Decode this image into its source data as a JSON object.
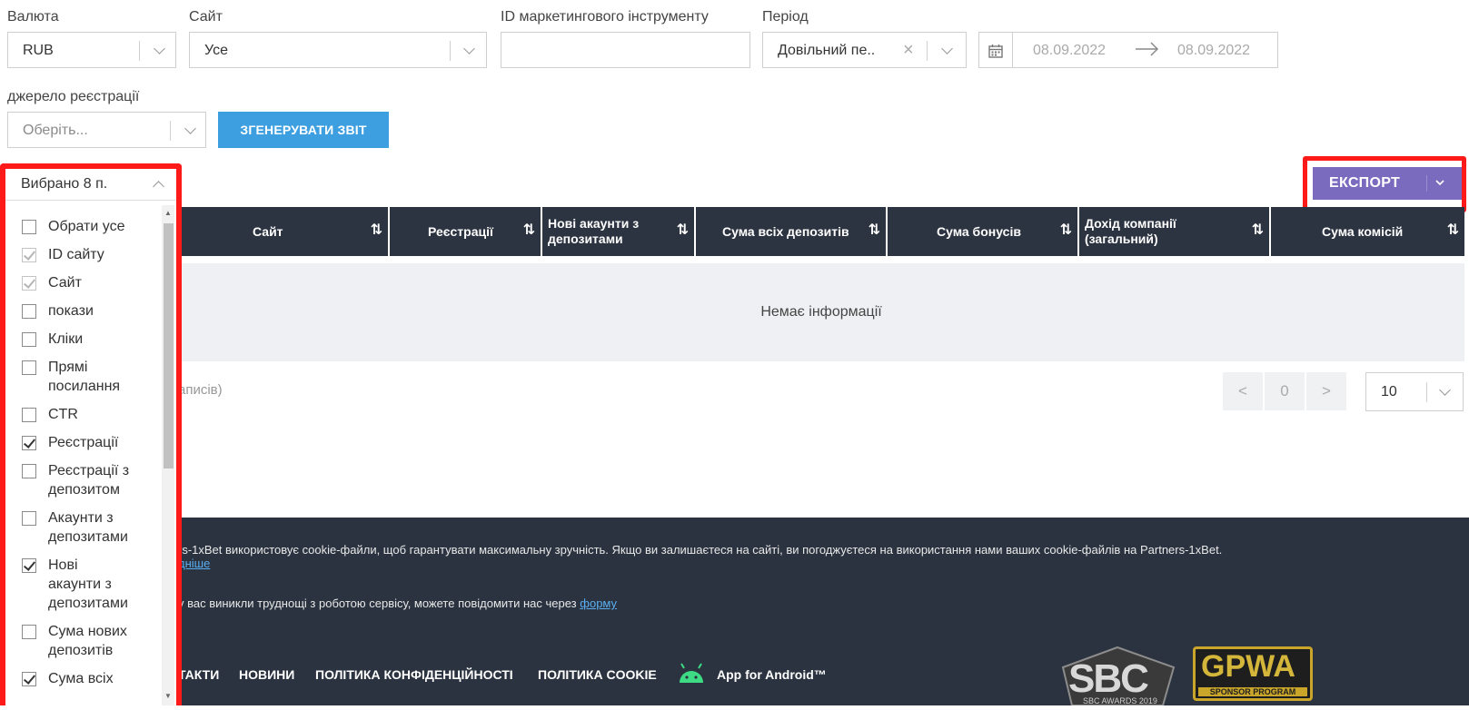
{
  "filters": {
    "currency": {
      "label": "Валюта",
      "value": "RUB"
    },
    "site": {
      "label": "Сайт",
      "value": "Усе"
    },
    "marketing_id": {
      "label": "ID маркетингового інструменту",
      "value": ""
    },
    "period": {
      "label": "Період",
      "value": "Довільний пе..",
      "date_from": "08.09.2022",
      "date_to": "08.09.2022"
    },
    "reg_source": {
      "label": "джерело реєстрації",
      "placeholder": "Оберіть..."
    },
    "generate_label": "ЗГЕНЕРУВАТИ ЗВІТ"
  },
  "export": {
    "label": "ЕКСПОРТ"
  },
  "columns_panel": {
    "title": "Вибрано 8 п.",
    "items": [
      {
        "line1": "Обрати усе",
        "line2": "",
        "line3": "",
        "state": "unchecked"
      },
      {
        "line1": "ID сайту",
        "line2": "",
        "line3": "",
        "state": "disabled"
      },
      {
        "line1": "Сайт",
        "line2": "",
        "line3": "",
        "state": "disabled"
      },
      {
        "line1": "покази",
        "line2": "",
        "line3": "",
        "state": "unchecked"
      },
      {
        "line1": "Кліки",
        "line2": "",
        "line3": "",
        "state": "unchecked"
      },
      {
        "line1": "Прямі",
        "line2": "посилання",
        "line3": "",
        "state": "unchecked"
      },
      {
        "line1": "CTR",
        "line2": "",
        "line3": "",
        "state": "unchecked"
      },
      {
        "line1": "Реєстрації",
        "line2": "",
        "line3": "",
        "state": "checked"
      },
      {
        "line1": "Реєстрації з",
        "line2": "депозитом",
        "line3": "",
        "state": "unchecked"
      },
      {
        "line1": "Акаунти з",
        "line2": "депозитами",
        "line3": "",
        "state": "unchecked"
      },
      {
        "line1": "Нові",
        "line2": "акаунти з",
        "line3": "депозитами",
        "state": "checked"
      },
      {
        "line1": "Сума нових",
        "line2": "депозитів",
        "line3": "",
        "state": "unchecked"
      },
      {
        "line1": "Сума всіх",
        "line2": "",
        "line3": "",
        "state": "checked"
      }
    ]
  },
  "table": {
    "headers": [
      {
        "line1": "Сайт",
        "line2": ""
      },
      {
        "line1": "Реєстрації",
        "line2": ""
      },
      {
        "line1": "Нові акаунти з",
        "line2": "депозитами"
      },
      {
        "line1": "Сума всіх депозитів",
        "line2": ""
      },
      {
        "line1": "Сума бонусів",
        "line2": ""
      },
      {
        "line1": "Дохід компанії",
        "line2": "(загальний)"
      },
      {
        "line1": "Сума комісій",
        "line2": ""
      }
    ],
    "empty_text": "Немає інформації",
    "records_text": "аписів)"
  },
  "pagination": {
    "prev": "<",
    "page": "0",
    "next": ">",
    "page_size": "10"
  },
  "footer": {
    "cookie_text": "rs-1xBet використовує cookie-файли, щоб гарантувати максимальну зручність. Якщо ви залишаєтеся на сайті, ви погоджуєтеся на використання нами ваших cookie-файлів на Partners-1xBet.",
    "cookie_link": "дніше",
    "help_text": "у вас виникли труднощі з роботою сервісу, можете повідомити нас через ",
    "help_link": "форму",
    "nav": {
      "contacts": "ТАКТИ",
      "news": "НОВИНИ",
      "privacy": "ПОЛІТИКА КОНФІДЕНЦІЙНОСТІ",
      "cookie_policy": "ПОЛІТИКА COOKIE",
      "android": "App for Android™"
    },
    "logos": {
      "sbc_main": "SBC",
      "sbc_sub": "SBC AWARDS 2019",
      "gpwa_main": "GPWA",
      "gpwa_sub": "SPONSOR PROGRAM"
    }
  }
}
